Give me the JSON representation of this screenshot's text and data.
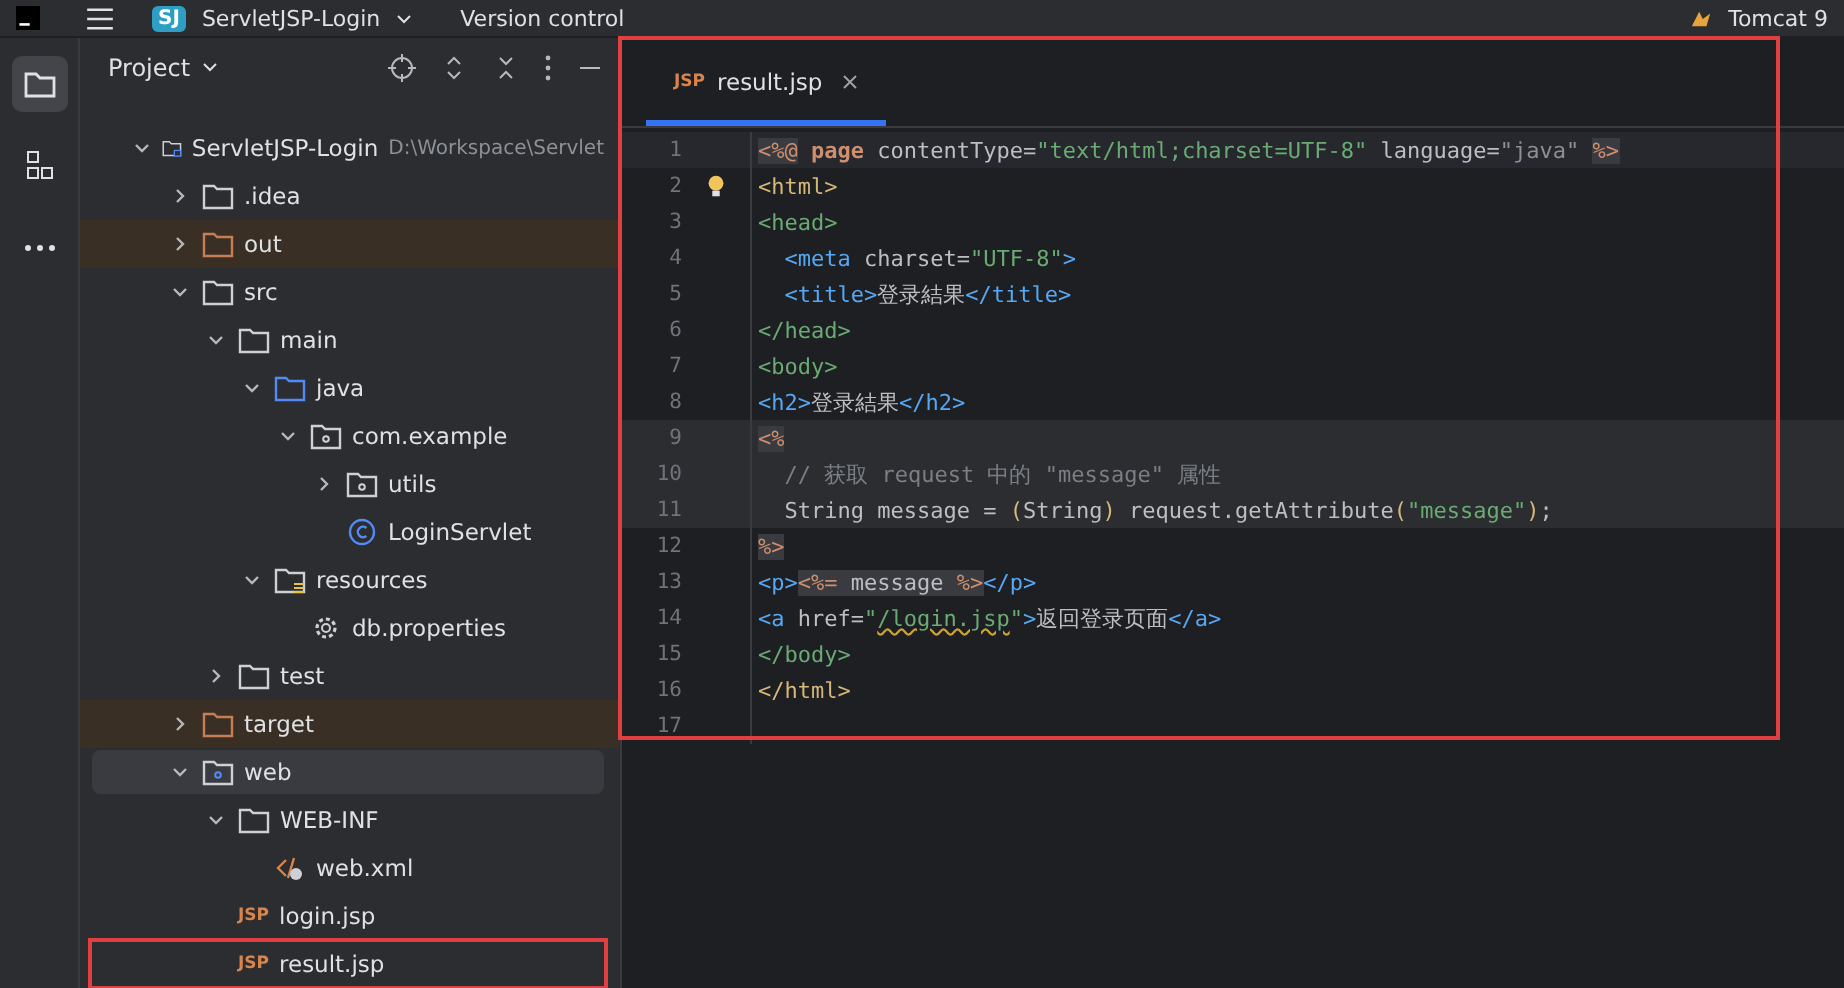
{
  "title_bar": {
    "project_badge": "SJ",
    "project_name": "ServletJSP-Login",
    "vcs": "Version control",
    "run_config": "Tomcat 9"
  },
  "project_panel": {
    "title": "Project",
    "tree": [
      {
        "label": "ServletJSP-Login",
        "path": "D:\\Workspace\\Servlet",
        "kind": "module",
        "expanded": true,
        "selected": false,
        "excluded": false,
        "children": [
          {
            "label": ".idea",
            "kind": "folder",
            "expanded": false,
            "selected": false,
            "excluded": false
          },
          {
            "label": "out",
            "kind": "folder",
            "expanded": false,
            "selected": false,
            "excluded": true
          },
          {
            "label": "src",
            "kind": "folder",
            "expanded": true,
            "selected": false,
            "excluded": false,
            "children": [
              {
                "label": "main",
                "kind": "folder",
                "expanded": true,
                "selected": false,
                "excluded": false,
                "children": [
                  {
                    "label": "java",
                    "kind": "source-root",
                    "expanded": true,
                    "selected": false,
                    "excluded": false,
                    "children": [
                      {
                        "label": "com.example",
                        "kind": "package",
                        "expanded": true,
                        "selected": false,
                        "excluded": false,
                        "children": [
                          {
                            "label": "utils",
                            "kind": "package",
                            "expanded": false,
                            "selected": false,
                            "excluded": false
                          },
                          {
                            "label": "LoginServlet",
                            "kind": "class",
                            "selected": false,
                            "excluded": false
                          }
                        ]
                      }
                    ]
                  },
                  {
                    "label": "resources",
                    "kind": "resource-root",
                    "expanded": true,
                    "selected": false,
                    "excluded": false,
                    "children": [
                      {
                        "label": "db.properties",
                        "kind": "properties",
                        "selected": false,
                        "excluded": false
                      }
                    ]
                  }
                ]
              },
              {
                "label": "test",
                "kind": "folder",
                "expanded": false,
                "selected": false,
                "excluded": false
              }
            ]
          },
          {
            "label": "target",
            "kind": "folder",
            "expanded": false,
            "selected": false,
            "excluded": true
          },
          {
            "label": "web",
            "kind": "web-root",
            "expanded": true,
            "selected": true,
            "excluded": false,
            "children": [
              {
                "label": "WEB-INF",
                "kind": "folder",
                "expanded": true,
                "selected": false,
                "excluded": false,
                "children": [
                  {
                    "label": "web.xml",
                    "kind": "xml",
                    "selected": false,
                    "excluded": false
                  }
                ]
              },
              {
                "label": "login.jsp",
                "kind": "file",
                "file_type": "JSP",
                "selected": false,
                "excluded": false
              },
              {
                "label": "result.jsp",
                "kind": "file",
                "file_type": "JSP",
                "selected": false,
                "excluded": false,
                "annotated": true
              }
            ]
          }
        ]
      }
    ]
  },
  "editor": {
    "annotated": true,
    "tabs": [
      {
        "label": "result.jsp",
        "file_type": "JSP",
        "selected": true
      }
    ],
    "lines": [
      {
        "number": "1",
        "current": true,
        "shaded": false,
        "tokens": [
          {
            "text": "<%@",
            "kind": "jsp"
          },
          {
            "text": " page",
            "kind": "keyword"
          },
          {
            "text": " contentType=",
            "kind": "attribute"
          },
          {
            "text": "\"text/html;charset=UTF-8\"",
            "kind": "string"
          },
          {
            "text": " language=",
            "kind": "attribute"
          },
          {
            "text": "\"java\" ",
            "kind": "muted"
          },
          {
            "text": "%>",
            "kind": "jsp"
          }
        ]
      },
      {
        "number": "2",
        "current": false,
        "shaded": false,
        "tokens": [
          {
            "text": "<html>",
            "kind": "root-tag"
          }
        ]
      },
      {
        "number": "3",
        "current": false,
        "shaded": false,
        "tokens": [
          {
            "text": "<head>",
            "kind": "section-tag"
          }
        ]
      },
      {
        "number": "4",
        "current": false,
        "shaded": false,
        "tokens": [
          {
            "text": "  <meta",
            "kind": "tag"
          },
          {
            "text": " charset=",
            "kind": "attribute"
          },
          {
            "text": "\"UTF-8\"",
            "kind": "string"
          },
          {
            "text": ">",
            "kind": "tag"
          }
        ]
      },
      {
        "number": "5",
        "current": false,
        "shaded": false,
        "tokens": [
          {
            "text": "  <title>",
            "kind": "tag"
          },
          {
            "text": "登录結果",
            "kind": "plain"
          },
          {
            "text": "</title>",
            "kind": "tag"
          }
        ]
      },
      {
        "number": "6",
        "current": false,
        "shaded": false,
        "tokens": [
          {
            "text": "</head>",
            "kind": "section-tag"
          }
        ]
      },
      {
        "number": "7",
        "current": false,
        "shaded": false,
        "tokens": [
          {
            "text": "<body>",
            "kind": "section-tag"
          }
        ]
      },
      {
        "number": "8",
        "current": false,
        "shaded": false,
        "tokens": [
          {
            "text": "<h2>",
            "kind": "tag"
          },
          {
            "text": "登录結果",
            "kind": "plain"
          },
          {
            "text": "</h2>",
            "kind": "tag"
          }
        ]
      },
      {
        "number": "9",
        "current": false,
        "shaded": true,
        "tokens": [
          {
            "text": "<%",
            "kind": "jsp"
          }
        ]
      },
      {
        "number": "10",
        "current": false,
        "shaded": true,
        "tokens": [
          {
            "text": "  // 获取 request 中的 \"message\" 属性",
            "kind": "comment"
          }
        ]
      },
      {
        "number": "11",
        "current": false,
        "shaded": true,
        "tokens": [
          {
            "text": "  String message = ",
            "kind": "plain"
          },
          {
            "text": "(",
            "kind": "paren"
          },
          {
            "text": "String",
            "kind": "plain"
          },
          {
            "text": ")",
            "kind": "paren"
          },
          {
            "text": " request.getAttribute",
            "kind": "plain"
          },
          {
            "text": "(",
            "kind": "paren"
          },
          {
            "text": "\"message\"",
            "kind": "string"
          },
          {
            "text": ")",
            "kind": "paren"
          },
          {
            "text": ";",
            "kind": "plain"
          }
        ]
      },
      {
        "number": "12",
        "current": false,
        "shaded": false,
        "tokens": [
          {
            "text": "%>",
            "kind": "jsp"
          }
        ]
      },
      {
        "number": "13",
        "current": false,
        "shaded": false,
        "tokens": [
          {
            "text": "<p>",
            "kind": "tag"
          },
          {
            "text": "<%=",
            "kind": "jsp"
          },
          {
            "text": " message ",
            "kind": "jsp-body"
          },
          {
            "text": "%>",
            "kind": "jsp"
          },
          {
            "text": "</p>",
            "kind": "tag"
          }
        ]
      },
      {
        "number": "14",
        "current": false,
        "shaded": false,
        "tokens": [
          {
            "text": "<a",
            "kind": "tag"
          },
          {
            "text": " href=",
            "kind": "attribute"
          },
          {
            "text": "\"",
            "kind": "string"
          },
          {
            "text": "/login.jsp",
            "kind": "string-warning"
          },
          {
            "text": "\"",
            "kind": "string"
          },
          {
            "text": ">",
            "kind": "tag"
          },
          {
            "text": "返回登录页面",
            "kind": "plain"
          },
          {
            "text": "</a>",
            "kind": "tag"
          }
        ]
      },
      {
        "number": "15",
        "current": false,
        "shaded": false,
        "tokens": [
          {
            "text": "</body>",
            "kind": "section-tag"
          }
        ]
      },
      {
        "number": "16",
        "current": false,
        "shaded": false,
        "tokens": [
          {
            "text": "</html>",
            "kind": "root-tag"
          }
        ]
      },
      {
        "number": "17",
        "current": false,
        "shaded": false
      }
    ]
  }
}
